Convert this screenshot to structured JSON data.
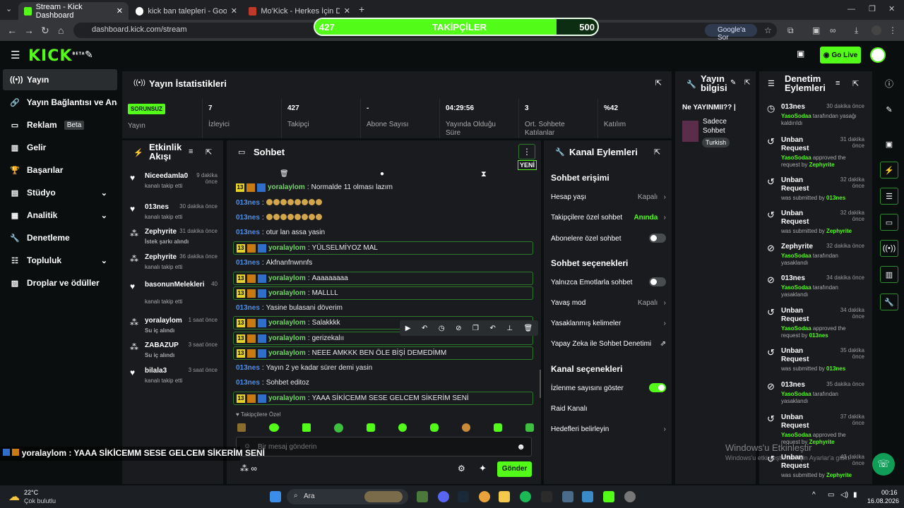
{
  "browser": {
    "tabs": [
      {
        "title": "Stream - Kick Dashboard",
        "active": true
      },
      {
        "title": "kick ban talepleri - Google'da A",
        "active": false
      },
      {
        "title": "Mo'Kick - Herkes İçin Daha İyi K",
        "active": false
      }
    ],
    "url": "dashboard.kick.com/stream",
    "google_btn": "Google'a Sor"
  },
  "overlay": {
    "left": "427",
    "label": "TAKİPÇİLER",
    "right": "500",
    "progress": 0.854
  },
  "header": {
    "logo": "KICK",
    "logo_sup": "BETA",
    "go_live": "Go Live"
  },
  "sidebar": {
    "items": [
      {
        "label": "Yayın",
        "icon": "broadcast-icon"
      },
      {
        "label": "Yayın Bağlantısı ve Anahtarı",
        "icon": "link-icon"
      },
      {
        "label": "Reklam",
        "icon": "ad-icon",
        "badge": "Beta"
      },
      {
        "label": "Gelir",
        "icon": "chart-icon"
      },
      {
        "label": "Başarılar",
        "icon": "trophy-icon"
      },
      {
        "label": "Stüdyo",
        "icon": "studio-icon"
      },
      {
        "label": "Analitik",
        "icon": "analytics-icon"
      },
      {
        "label": "Denetleme",
        "icon": "wrench-icon"
      },
      {
        "label": "Topluluk",
        "icon": "community-icon"
      },
      {
        "label": "Droplar ve ödüller",
        "icon": "gift-icon"
      }
    ]
  },
  "stats": {
    "title": "Yayın İstatistikleri",
    "status": "SORUNSUZ",
    "status_label": "Yayın",
    "items": [
      {
        "value": "7",
        "label": "İzleyici"
      },
      {
        "value": "427",
        "label": "Takipçi"
      },
      {
        "value": "-",
        "label": "Abone Sayısı"
      },
      {
        "value": "04:29:56",
        "label": "Yayında Olduğu Süre"
      },
      {
        "value": "3",
        "label": "Ort. Sohbete Katılanlar"
      },
      {
        "value": "%42",
        "label": "Katılım"
      }
    ]
  },
  "activity": {
    "title": "Etkinlik Akışı",
    "items": [
      {
        "name": "Niceedamla0",
        "time": "9 dakika önce",
        "desc": "kanalı takip etti",
        "icon": "heart-icon"
      },
      {
        "name": "013nes",
        "time": "30 dakika önce",
        "desc": "kanalı takip etti",
        "icon": "heart-icon"
      },
      {
        "name": "Zephyrite",
        "time": "31 dakika önce",
        "desc": "İstek şarkı alındı",
        "icon": "points-icon"
      },
      {
        "name": "Zephyrite",
        "time": "36 dakika önce",
        "desc": "kanalı takip etti",
        "icon": "points-icon"
      },
      {
        "name": "basonunMelekleri",
        "time": "40",
        "desc": "kanalı takip etti",
        "icon": "heart-icon"
      },
      {
        "name": "yoralaylom",
        "time": "1 saat önce",
        "desc": "Su iç alındı",
        "icon": "points-icon"
      },
      {
        "name": "ZABAZUP",
        "time": "3 saat önce",
        "desc": "Su iç alındı",
        "icon": "points-icon"
      },
      {
        "name": "bilala3",
        "time": "3 saat önce",
        "desc": "kanalı takip etti",
        "icon": "heart-icon"
      }
    ]
  },
  "chat": {
    "title": "Sohbet",
    "new_label": "YENİ",
    "messages": [
      {
        "user": "yoralaylom",
        "text": "Normalde 11 olması lazım",
        "badges": true
      },
      {
        "user": "013nes",
        "text": "",
        "emotes": 8
      },
      {
        "user": "013nes",
        "text": "",
        "emotes": 8
      },
      {
        "user": "013nes",
        "text": "otur lan assa yasin"
      },
      {
        "user": "yoralaylom",
        "text": "YÜLSELMİYOZ MAL",
        "badges": true
      },
      {
        "user": "013nes",
        "text": "Akfnanfnwnnfs"
      },
      {
        "user": "yoralaylom",
        "text": "Aaaaaaaaa",
        "badges": true
      },
      {
        "user": "yoralaylom",
        "text": "MALLLL",
        "badges": true
      },
      {
        "user": "013nes",
        "text": "Yasine bulasani döverim"
      },
      {
        "user": "yoralaylom",
        "text": "Salakkkk",
        "badges": true
      },
      {
        "user": "yoralaylom",
        "text": "gerizekalıı",
        "badges": true
      },
      {
        "user": "yoralaylom",
        "text": "NEEE AMKKK BEN ÖLE BİŞİ DEMEDİMM",
        "badges": true
      },
      {
        "user": "013nes",
        "text": "Yayın 2 ye kadar sürer demi yasin"
      },
      {
        "user": "013nes",
        "text": "Sohbet editoz"
      },
      {
        "user": "yoralaylom",
        "text": "YAAA SİKİCEMM SESE GELCEM SİKERİM SENİ",
        "badges": true
      }
    ],
    "followers_only": "Takipçilere Özel",
    "placeholder": "Bir mesaj gönderin",
    "send": "Gönder",
    "pinned_overlay": "yoralaylom : YAAA SİKİCEMM SESE GELCEM SİKERİM SENİ"
  },
  "channel": {
    "title": "Kanal Eylemleri",
    "access_title": "Sohbet erişimi",
    "access": [
      {
        "label": "Hesap yaşı",
        "value": "Kapalı",
        "type": "chevron"
      },
      {
        "label": "Takipçilere özel sohbet",
        "value": "Anında",
        "type": "chevron"
      },
      {
        "label": "Abonelere özel sohbet",
        "type": "toggle",
        "on": false
      }
    ],
    "options_title": "Sohbet seçenekleri",
    "options": [
      {
        "label": "Yalnızca Emotlarla sohbet",
        "type": "toggle",
        "on": false
      },
      {
        "label": "Yavaş mod",
        "value": "Kapalı",
        "type": "chevron"
      },
      {
        "label": "Yasaklanmış kelimeler",
        "type": "chevron"
      },
      {
        "label": "Yapay Zeka ile Sohbet Denetimi",
        "type": "external"
      }
    ],
    "channel_title": "Kanal seçenekleri",
    "channel_opts": [
      {
        "label": "İzlenme sayısını göster",
        "type": "toggle",
        "on": true
      },
      {
        "label": "Raid Kanalı",
        "type": "none"
      },
      {
        "label": "Hedefleri belirleyin",
        "type": "chevron"
      }
    ]
  },
  "stream_info": {
    "title": "Yayın bilgisi",
    "stream_title": "Ne YAYINMII?? |",
    "category": "Sadece Sohbet",
    "language": "Turkish"
  },
  "modlog": {
    "title": "Denetim Eylemleri",
    "items": [
      {
        "icon": "clock-icon",
        "title": "013nes",
        "time": "30 dakika önce",
        "by": "YasoSodaa",
        "desc": "tarafından yasağı kaldırıldı"
      },
      {
        "icon": "undo-icon",
        "title": "Unban Request",
        "time": "31 dakika önce",
        "by": "YasoSodaa",
        "desc": "approved the request by",
        "target": "Zephyrite"
      },
      {
        "icon": "undo-icon",
        "title": "Unban Request",
        "time": "32 dakika önce",
        "desc": "was submitted by",
        "target": "013nes"
      },
      {
        "icon": "undo-icon",
        "title": "Unban Request",
        "time": "32 dakika önce",
        "desc": "was submitted by",
        "target": "Zephyrite"
      },
      {
        "icon": "ban-icon",
        "title": "Zephyrite",
        "time": "32 dakika önce",
        "by": "YasoSodaa",
        "desc": "tarafından yasaklandı"
      },
      {
        "icon": "ban-icon",
        "title": "013nes",
        "time": "34 dakika önce",
        "by": "YasoSodaa",
        "desc": "tarafından yasaklandı"
      },
      {
        "icon": "undo-icon",
        "title": "Unban Request",
        "time": "34 dakika önce",
        "by": "YasoSodaa",
        "desc": "approved the request by",
        "target": "013nes"
      },
      {
        "icon": "undo-icon",
        "title": "Unban Request",
        "time": "35 dakika önce",
        "desc": "was submitted by",
        "target": "013nes"
      },
      {
        "icon": "ban-icon",
        "title": "013nes",
        "time": "35 dakika önce",
        "by": "YasoSodaa",
        "desc": "tarafından yasaklandı"
      },
      {
        "icon": "undo-icon",
        "title": "Unban Request",
        "time": "37 dakika önce",
        "by": "YasoSodaa",
        "desc": "approved the request by",
        "target": "Zephyrite"
      },
      {
        "icon": "undo-icon",
        "title": "Unban Request",
        "time": "43 dakika önce",
        "desc": "was submitted by",
        "target": "Zephyrite"
      }
    ]
  },
  "windows_watermark": {
    "line1": "Windows'u Etkinleştir",
    "line2": "Windows'u etkinleştirmek için Ayarlar'a gidin."
  },
  "taskbar": {
    "weather_temp": "22°C",
    "weather_desc": "Çok bulutlu",
    "search": "Ara",
    "time": "00:16",
    "date": "16.08.2026"
  },
  "colors": {
    "accent": "#53fc18",
    "panel": "#191b1f",
    "bg": "#0b0e0f"
  }
}
